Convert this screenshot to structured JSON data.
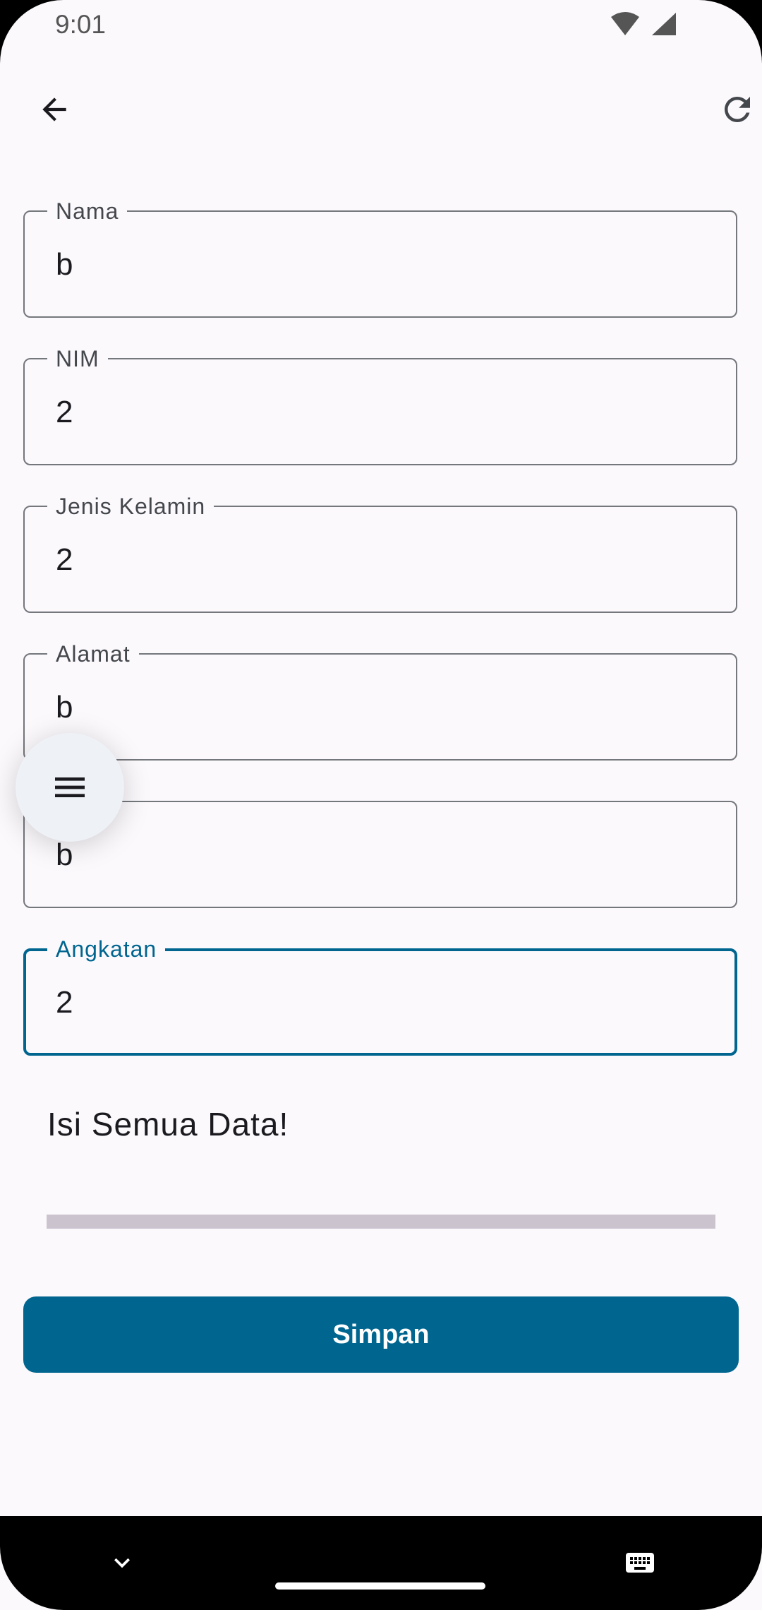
{
  "status_bar": {
    "time": "9:01"
  },
  "top_bar": {
    "back_icon": "arrow-back-icon",
    "refresh_icon": "refresh-icon"
  },
  "form": {
    "fields": [
      {
        "label": "Nama",
        "value": "b",
        "focused": false
      },
      {
        "label": "NIM",
        "value": "2",
        "focused": false
      },
      {
        "label": "Jenis Kelamin",
        "value": "2",
        "focused": false
      },
      {
        "label": "Alamat",
        "value": "b",
        "focused": false
      },
      {
        "label": "",
        "value": "b",
        "focused": false
      },
      {
        "label": "Angkatan",
        "value": "2",
        "focused": true
      }
    ],
    "message": "Isi Semua Data!",
    "progress": 0,
    "save_label": "Simpan"
  },
  "fab": {
    "icon": "menu-icon"
  },
  "nav_bar": {
    "collapse_icon": "chevron-down-icon",
    "keyboard_icon": "keyboard-icon"
  },
  "colors": {
    "primary": "#00658f",
    "background": "#fbf9fc",
    "outline": "#74777c",
    "progress_track": "#cbc4cf"
  }
}
